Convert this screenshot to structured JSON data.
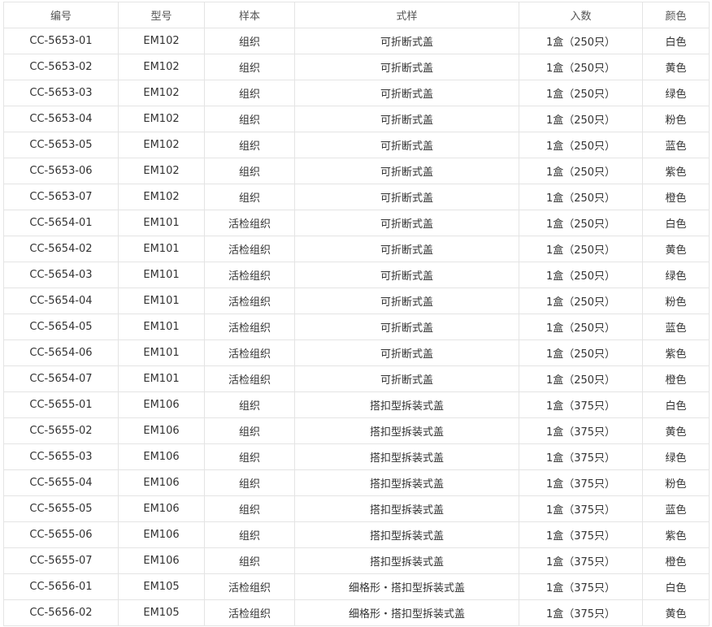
{
  "table": {
    "headers": [
      "编号",
      "型号",
      "样本",
      "式样",
      "入数",
      "颜色"
    ],
    "rows": [
      [
        "CC-5653-01",
        "EM102",
        "组织",
        "可折断式盖",
        "1盒（250只）",
        "白色"
      ],
      [
        "CC-5653-02",
        "EM102",
        "组织",
        "可折断式盖",
        "1盒（250只）",
        "黄色"
      ],
      [
        "CC-5653-03",
        "EM102",
        "组织",
        "可折断式盖",
        "1盒（250只）",
        "绿色"
      ],
      [
        "CC-5653-04",
        "EM102",
        "组织",
        "可折断式盖",
        "1盒（250只）",
        "粉色"
      ],
      [
        "CC-5653-05",
        "EM102",
        "组织",
        "可折断式盖",
        "1盒（250只）",
        "蓝色"
      ],
      [
        "CC-5653-06",
        "EM102",
        "组织",
        "可折断式盖",
        "1盒（250只）",
        "紫色"
      ],
      [
        "CC-5653-07",
        "EM102",
        "组织",
        "可折断式盖",
        "1盒（250只）",
        "橙色"
      ],
      [
        "CC-5654-01",
        "EM101",
        "活检组织",
        "可折断式盖",
        "1盒（250只）",
        "白色"
      ],
      [
        "CC-5654-02",
        "EM101",
        "活检组织",
        "可折断式盖",
        "1盒（250只）",
        "黄色"
      ],
      [
        "CC-5654-03",
        "EM101",
        "活检组织",
        "可折断式盖",
        "1盒（250只）",
        "绿色"
      ],
      [
        "CC-5654-04",
        "EM101",
        "活检组织",
        "可折断式盖",
        "1盒（250只）",
        "粉色"
      ],
      [
        "CC-5654-05",
        "EM101",
        "活检组织",
        "可折断式盖",
        "1盒（250只）",
        "蓝色"
      ],
      [
        "CC-5654-06",
        "EM101",
        "活检组织",
        "可折断式盖",
        "1盒（250只）",
        "紫色"
      ],
      [
        "CC-5654-07",
        "EM101",
        "活检组织",
        "可折断式盖",
        "1盒（250只）",
        "橙色"
      ],
      [
        "CC-5655-01",
        "EM106",
        "组织",
        "搭扣型拆装式盖",
        "1盒（375只）",
        "白色"
      ],
      [
        "CC-5655-02",
        "EM106",
        "组织",
        "搭扣型拆装式盖",
        "1盒（375只）",
        "黄色"
      ],
      [
        "CC-5655-03",
        "EM106",
        "组织",
        "搭扣型拆装式盖",
        "1盒（375只）",
        "绿色"
      ],
      [
        "CC-5655-04",
        "EM106",
        "组织",
        "搭扣型拆装式盖",
        "1盒（375只）",
        "粉色"
      ],
      [
        "CC-5655-05",
        "EM106",
        "组织",
        "搭扣型拆装式盖",
        "1盒（375只）",
        "蓝色"
      ],
      [
        "CC-5655-06",
        "EM106",
        "组织",
        "搭扣型拆装式盖",
        "1盒（375只）",
        "紫色"
      ],
      [
        "CC-5655-07",
        "EM106",
        "组织",
        "搭扣型拆装式盖",
        "1盒（375只）",
        "橙色"
      ],
      [
        "CC-5656-01",
        "EM105",
        "活检组织",
        "细格形・搭扣型拆装式盖",
        "1盒（375只）",
        "白色"
      ],
      [
        "CC-5656-02",
        "EM105",
        "活检组织",
        "细格形・搭扣型拆装式盖",
        "1盒（375只）",
        "黄色"
      ]
    ]
  }
}
